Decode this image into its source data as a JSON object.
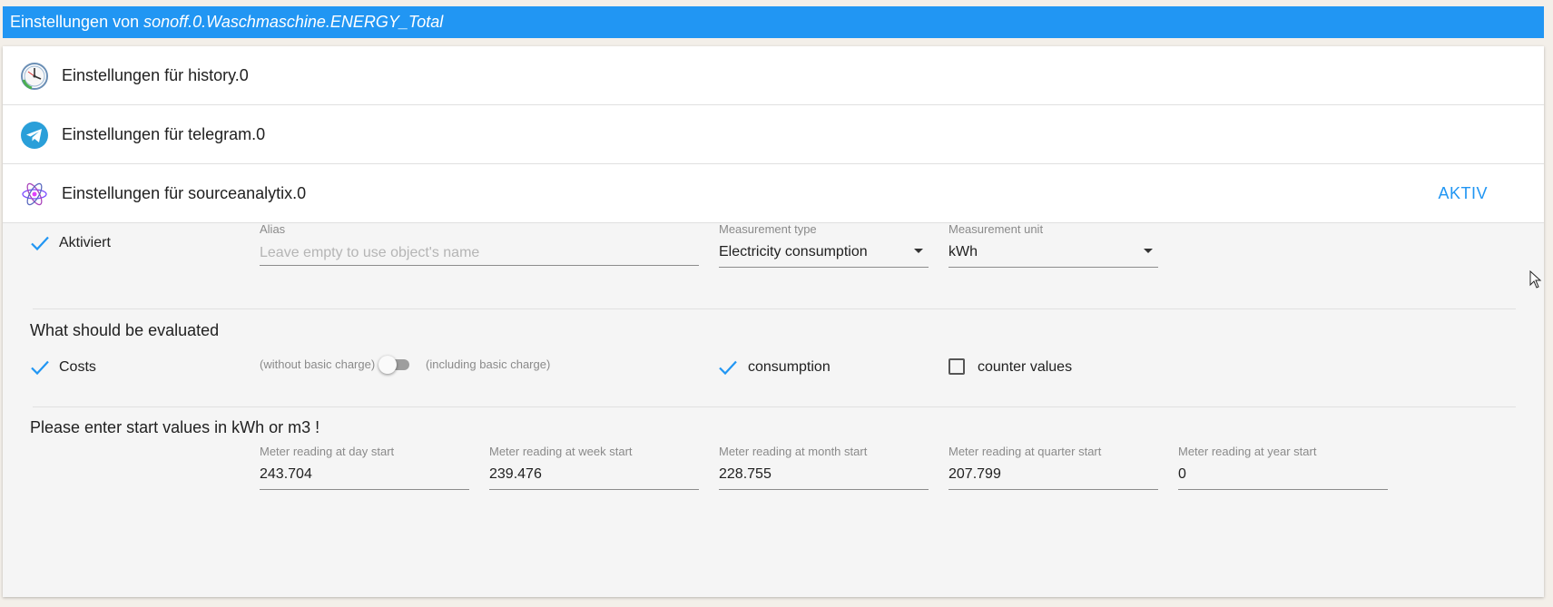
{
  "dialog": {
    "title_prefix": "Einstellungen von ",
    "title_object": "sonoff.0.Waschmaschine.ENERGY_Total"
  },
  "adapters": [
    {
      "label": "Einstellungen für history.0",
      "icon": "history-clock-icon"
    },
    {
      "label": "Einstellungen für telegram.0",
      "icon": "telegram-icon"
    },
    {
      "label": "Einstellungen für sourceanalytix.0",
      "icon": "atom-icon",
      "status": "AKTIV"
    }
  ],
  "settings": {
    "enabled_label": "Aktiviert",
    "enabled_checked": true,
    "alias_label": "Alias",
    "alias_placeholder": "Leave empty to use object's name",
    "alias_value": "",
    "measurement_type_label": "Measurement type",
    "measurement_type_value": "Electricity consumption",
    "measurement_unit_label": "Measurement unit",
    "measurement_unit_value": "kWh"
  },
  "evaluation": {
    "title": "What should be evaluated",
    "costs_label": "Costs",
    "costs_checked": true,
    "without_basic_charge": "(without basic charge)",
    "including_basic_charge": "(including basic charge)",
    "basic_charge_on": false,
    "consumption_label": "consumption",
    "consumption_checked": true,
    "counter_values_label": "counter values",
    "counter_values_checked": false
  },
  "start_values": {
    "title": "Please enter start values in kWh or m3 !",
    "fields": [
      {
        "label": "Meter reading at day start",
        "value": "243.704"
      },
      {
        "label": "Meter reading at week start",
        "value": "239.476"
      },
      {
        "label": "Meter reading at month start",
        "value": "228.755"
      },
      {
        "label": "Meter reading at quarter start",
        "value": "207.799"
      },
      {
        "label": "Meter reading at year start",
        "value": "0"
      }
    ]
  },
  "colors": {
    "accent": "#2196f3",
    "panel_bg": "#f5f5f5",
    "page_bg": "#f3efe9"
  }
}
